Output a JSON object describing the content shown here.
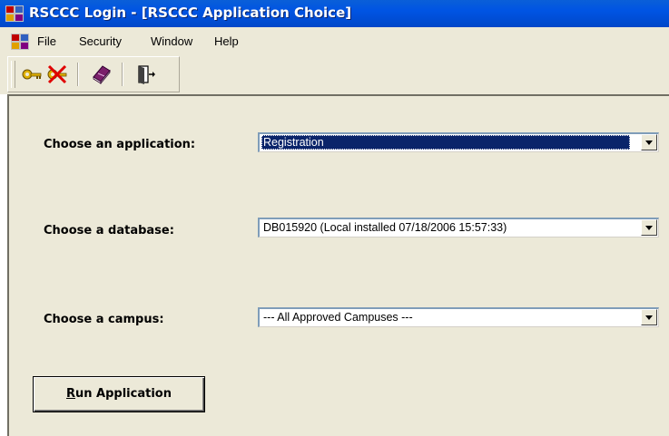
{
  "window": {
    "title": "RSCCC Login - [RSCCC Application Choice]"
  },
  "menu": {
    "items": [
      "File",
      "Security",
      "Window",
      "Help"
    ]
  },
  "toolbar": {
    "buttons": [
      "key-icon",
      "no-key-icon",
      "book-icon",
      "exit-door-icon"
    ]
  },
  "form": {
    "application": {
      "label": "Choose an application:",
      "value": "Registration"
    },
    "database": {
      "label": "Choose a database:",
      "value": "DB015920 (Local installed 07/18/2006 15:57:33)"
    },
    "campus": {
      "label": "Choose a campus:",
      "value": "--- All Approved Campuses ---"
    },
    "run_button": {
      "mnemonic": "R",
      "rest": "un Application"
    }
  },
  "colors": {
    "title_bar": "#0054e3",
    "selection": "#0a246a",
    "face": "#ece9d8"
  }
}
